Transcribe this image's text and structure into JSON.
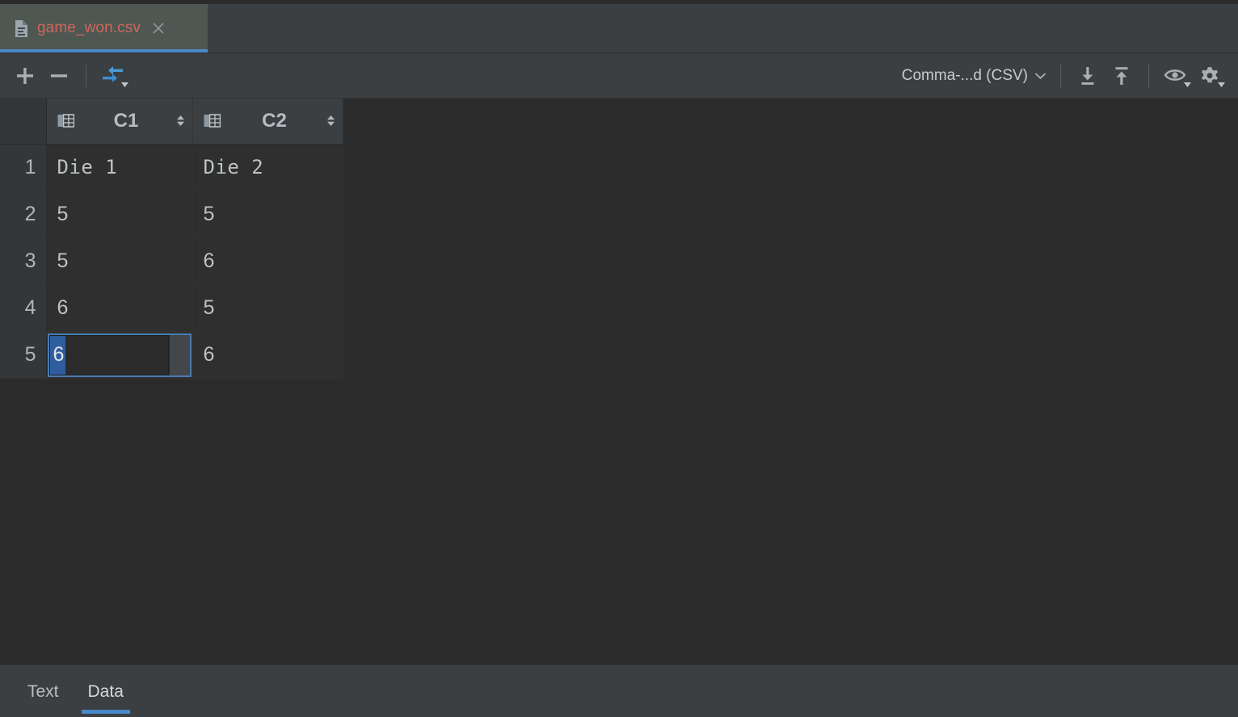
{
  "window": {
    "background_color": "#2b2b2b",
    "panel_color": "#3c3f41",
    "accent_color": "#4a88c7"
  },
  "tabbar": {
    "tabs": [
      {
        "title": "game_won.csv",
        "icon": "csv-file-icon",
        "close_icon": "close-icon",
        "active": true,
        "title_color": "#d2675c",
        "tab_background": "#4e5751"
      }
    ]
  },
  "toolbar": {
    "add_row_label": "+",
    "remove_row_label": "−",
    "add_row_name": "add-row-button",
    "remove_row_name": "remove-row-button",
    "transpose_name": "transpose-button",
    "format": {
      "label": "Comma-...d (CSV)",
      "caret_icon": "chevron-down-icon"
    },
    "import_icon": "import-download-icon",
    "export_icon": "export-upload-icon",
    "view_icon": "eye-view-icon",
    "settings_icon": "gear-settings-icon"
  },
  "grid": {
    "columns": [
      {
        "id": "C1",
        "label": "C1",
        "icon": "column-table-icon",
        "sort_icon": "sort-arrows-icon"
      },
      {
        "id": "C2",
        "label": "C2",
        "icon": "column-table-icon",
        "sort_icon": "sort-arrows-icon"
      }
    ],
    "rows": [
      {
        "number": "1",
        "c1": "Die 1",
        "c2": "Die 2",
        "header_row": true
      },
      {
        "number": "2",
        "c1": "5",
        "c2": "5",
        "header_row": false
      },
      {
        "number": "3",
        "c1": "5",
        "c2": "6",
        "header_row": false
      },
      {
        "number": "4",
        "c1": "6",
        "c2": "5",
        "header_row": false
      },
      {
        "number": "5",
        "c1": "6",
        "c2": "6",
        "header_row": false
      }
    ],
    "editing_cell": {
      "row_number": "5",
      "column": "C1",
      "value": "6",
      "selected": true,
      "selection_color": "#2f5d9e",
      "border_color": "#4a7cb0"
    }
  },
  "bottom_tabs": {
    "tabs": [
      {
        "label": "Text",
        "active": false
      },
      {
        "label": "Data",
        "active": true
      }
    ]
  }
}
